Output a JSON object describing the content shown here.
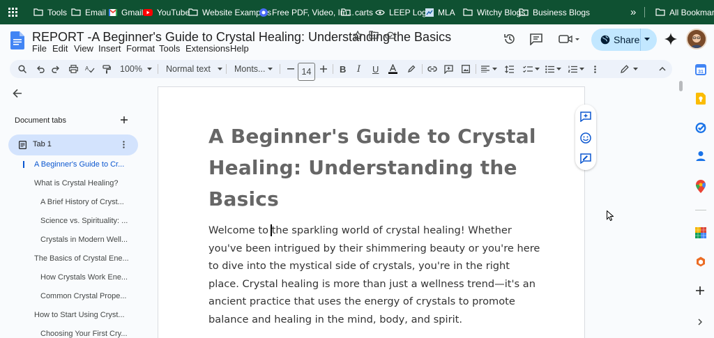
{
  "bookmarks_bar": {
    "items": [
      {
        "label": "Tools",
        "icon": "folder-icon"
      },
      {
        "label": "Email",
        "icon": "folder-icon"
      },
      {
        "label": "Gmail",
        "icon": "gmail-icon"
      },
      {
        "label": "YouTube",
        "icon": "youtube-icon"
      },
      {
        "label": "Website Examples",
        "icon": "folder-icon"
      },
      {
        "label": "Free PDF, Video, Im...",
        "icon": "site-icon"
      },
      {
        "label": "carts",
        "icon": "folder-icon"
      },
      {
        "label": "LEEP Login",
        "icon": "site-icon"
      },
      {
        "label": "MLA",
        "icon": "site-icon"
      },
      {
        "label": "Witchy Blogs",
        "icon": "folder-icon"
      },
      {
        "label": "Business Blogs",
        "icon": "folder-icon"
      }
    ],
    "overflow": "»",
    "all_bookmarks": "All Bookmarks"
  },
  "header": {
    "title": "REPORT -A Beginner's Guide to Crystal Healing: Understanding the Basics",
    "menu": [
      "File",
      "Edit",
      "View",
      "Insert",
      "Format",
      "Tools",
      "Extensions",
      "Help"
    ],
    "share_label": "Share"
  },
  "toolbar": {
    "zoom": "100%",
    "style": "Normal text",
    "font": "Monts...",
    "font_size": "14"
  },
  "left_panel": {
    "section_title": "Document tabs",
    "tab_label": "Tab 1",
    "outline": [
      {
        "text": "A Beginner's Guide to Cr...",
        "level": 0,
        "active": true
      },
      {
        "text": "What is Crystal Healing?",
        "level": 1
      },
      {
        "text": "A Brief History of Cryst...",
        "level": 2
      },
      {
        "text": "Science vs. Spirituality: ...",
        "level": 2
      },
      {
        "text": "Crystals in Modern Well...",
        "level": 2
      },
      {
        "text": "The Basics of Crystal Ene...",
        "level": 1
      },
      {
        "text": "How Crystals Work Ene...",
        "level": 2
      },
      {
        "text": "Common Crystal Prope...",
        "level": 2
      },
      {
        "text": "How to Start Using Cryst...",
        "level": 1
      },
      {
        "text": "Choosing Your First Cry...",
        "level": 2
      }
    ]
  },
  "document": {
    "heading": "A Beginner's Guide to Crystal Healing: Understanding the Basics",
    "body": "Welcome to the sparkling world of crystal healing! Whether you've been intrigued by their shimmering beauty or you're here to dive into the mystical side of crystals, you're in the right place. Crystal healing is more than just a wellness trend—it's an ancient practice that uses the energy of crystals to promote balance and healing in the mind, body, and spirit."
  },
  "colors": {
    "bookmark_bar": "#0f5132",
    "accent": "#0b57d0",
    "share_bg": "#c2e7ff",
    "tab_active": "#d3e3fd"
  }
}
